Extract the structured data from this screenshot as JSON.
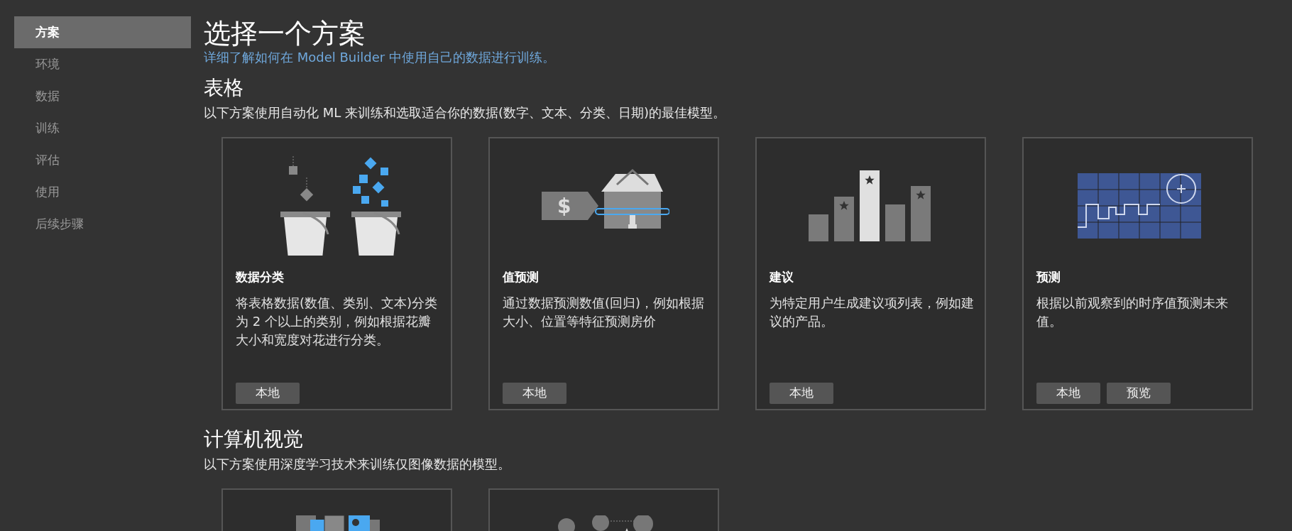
{
  "sidebar": {
    "items": [
      {
        "label": "方案",
        "selected": true
      },
      {
        "label": "环境",
        "selected": false
      },
      {
        "label": "数据",
        "selected": false
      },
      {
        "label": "训练",
        "selected": false
      },
      {
        "label": "评估",
        "selected": false
      },
      {
        "label": "使用",
        "selected": false
      },
      {
        "label": "后续步骤",
        "selected": false
      }
    ]
  },
  "header": {
    "title": "选择一个方案",
    "link": "详细了解如何在 Model Builder 中使用自己的数据进行训练。"
  },
  "sections": [
    {
      "heading": "表格",
      "description": "以下方案使用自动化 ML 来训练和选取适合你的数据(数字、文本、分类、日期)的最佳模型。",
      "cards": [
        {
          "kind": "buckets",
          "title": "数据分类",
          "description": "将表格数据(数值、类别、文本)分类为 2 个以上的类别，例如根据花瓣大小和宽度对花进行分类。",
          "buttons": [
            "本地"
          ]
        },
        {
          "kind": "house",
          "tag_symbol": "$",
          "title": "值预测",
          "description": "通过数据预测数值(回归)，例如根据大小、位置等特征预测房价",
          "buttons": [
            "本地"
          ]
        },
        {
          "kind": "bars",
          "title": "建议",
          "description": "为特定用户生成建议项列表，例如建议的产品。",
          "buttons": [
            "本地"
          ]
        },
        {
          "kind": "timeseries",
          "title": "预测",
          "description": "根据以前观察到的时序值预测未来值。",
          "buttons": [
            "本地",
            "预览"
          ]
        }
      ]
    },
    {
      "heading": "计算机视觉",
      "description": "以下方案使用深度学习技术来训练仅图像数据的模型。",
      "cards": [
        {
          "kind": "image-tiles"
        },
        {
          "kind": "clouds"
        }
      ]
    }
  ]
}
